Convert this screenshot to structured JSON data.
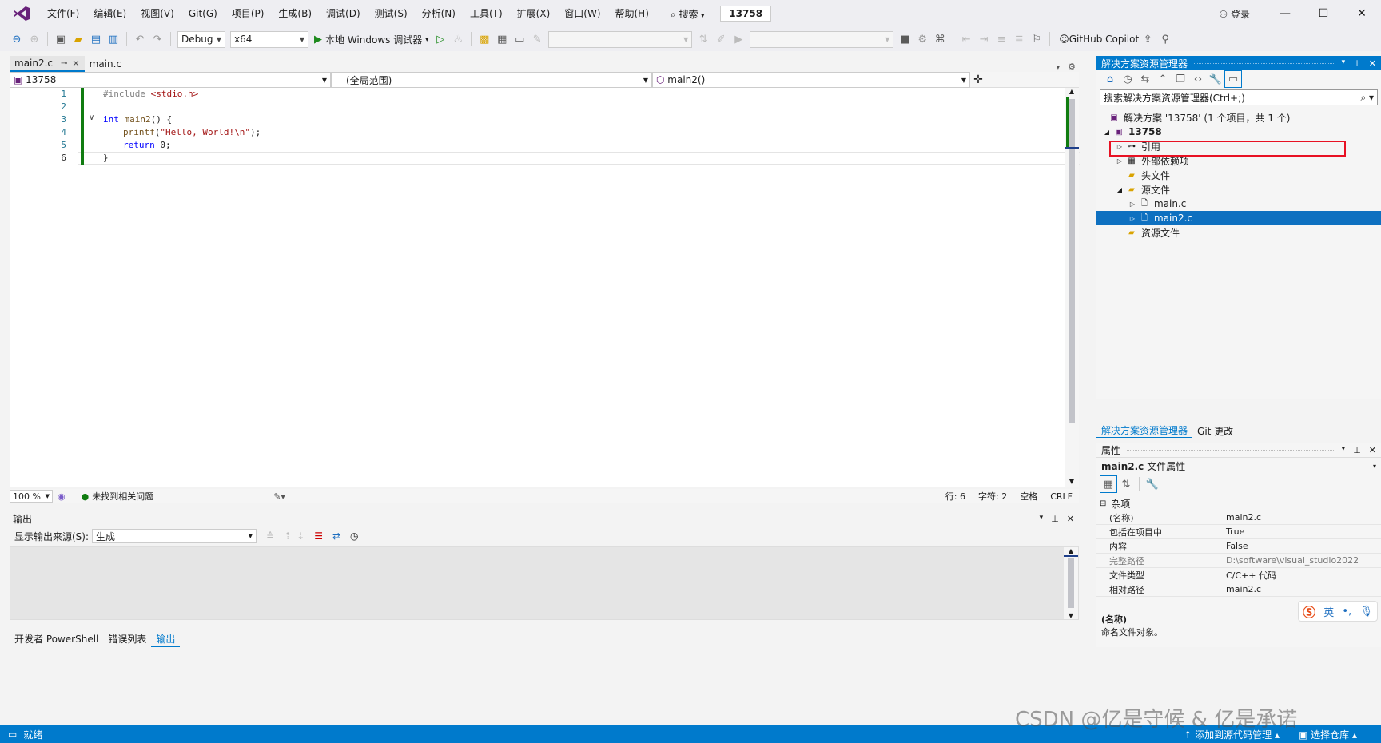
{
  "menu": {
    "items": [
      "文件(F)",
      "编辑(E)",
      "视图(V)",
      "Git(G)",
      "项目(P)",
      "生成(B)",
      "调试(D)",
      "测试(S)",
      "分析(N)",
      "工具(T)",
      "扩展(X)",
      "窗口(W)",
      "帮助(H)"
    ],
    "search_label": "搜索",
    "solution_name": "13758",
    "login_label": "登录"
  },
  "toolbar": {
    "config": "Debug",
    "platform": "x64",
    "run_label": "本地 Windows 调试器",
    "copilot_label": "GitHub Copilot"
  },
  "tabs": [
    {
      "label": "main2.c"
    },
    {
      "label": "main.c"
    }
  ],
  "navbar": {
    "project": "13758",
    "scope": "(全局范围)",
    "function": "main2()"
  },
  "code": {
    "line_numbers": [
      "1",
      "2",
      "3",
      "4",
      "5",
      "6"
    ],
    "l1_pp": "#include ",
    "l1_str": "<stdio.h>",
    "l3_kw": "int",
    "l3_fn": " main2",
    "l3_rest": "() {",
    "l4_fn": "printf",
    "l4_open": "(",
    "l4_str": "\"Hello, World!\\n\"",
    "l4_close": ");",
    "l5_kw": "return",
    "l5_rest": " 0;",
    "l6": "}"
  },
  "editor_status": {
    "zoom": "100 %",
    "issues": "未找到相关问题",
    "line": "行: 6",
    "char": "字符: 2",
    "space": "空格",
    "eol": "CRLF"
  },
  "output": {
    "title": "输出",
    "source_label": "显示输出来源(S):",
    "source_value": "生成"
  },
  "bottom_tabs": [
    "开发者 PowerShell",
    "错误列表",
    "输出"
  ],
  "solution_explorer": {
    "title": "解决方案资源管理器",
    "search_placeholder": "搜索解决方案资源管理器(Ctrl+;)",
    "tree": [
      {
        "label": "解决方案 '13758' (1 个项目，共 1 个)"
      },
      {
        "label": "13758"
      },
      {
        "label": "引用"
      },
      {
        "label": "外部依赖项"
      },
      {
        "label": "头文件"
      },
      {
        "label": "源文件"
      },
      {
        "label": "main.c"
      },
      {
        "label": "main2.c"
      },
      {
        "label": "资源文件"
      }
    ],
    "bottom_tabs": [
      "解决方案资源管理器",
      "Git 更改"
    ]
  },
  "properties": {
    "title": "属性",
    "object_name": "main2.c",
    "object_type": "文件属性",
    "section": "杂项",
    "rows": [
      {
        "key": "(名称)",
        "value": "main2.c"
      },
      {
        "key": "包括在项目中",
        "value": "True"
      },
      {
        "key": "内容",
        "value": "False"
      },
      {
        "key": "完整路径",
        "value": "D:\\software\\visual_studio2022"
      },
      {
        "key": "文件类型",
        "value": "C/C++ 代码"
      },
      {
        "key": "相对路径",
        "value": "main2.c"
      }
    ],
    "desc_title": "(名称)",
    "desc_text": "命名文件对象。"
  },
  "statusbar": {
    "ready": "就绪",
    "add_source": "添加到源代码管理",
    "select_repo": "选择仓库"
  },
  "watermark": "CSDN @亿是守候 & 亿是承诺",
  "ime": {
    "lang": "英"
  }
}
